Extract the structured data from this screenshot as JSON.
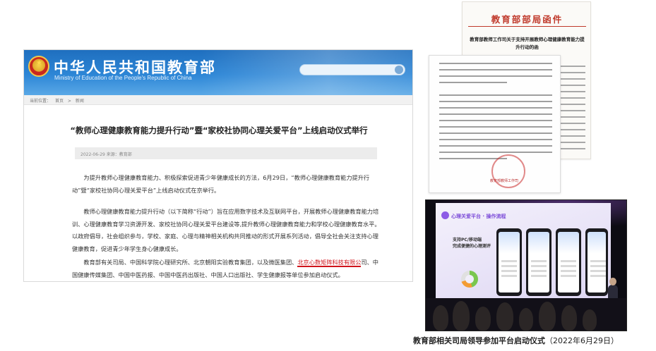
{
  "webpage": {
    "site_title": "中华人民共和国教育部",
    "site_subtitle": "Ministry of Education of the People's Republic of China",
    "breadcrumb": [
      "当前位置：",
      "首页",
      ">",
      "新闻"
    ],
    "article_title": "“教师心理健康教育能力提升行动”暨“家校社协同心理关爱平台”上线启动仪式举行",
    "article_meta": "2022-06-29    来源：教育部",
    "paragraph_1": "为提升教师心理健康教育能力、积极探索促进青少年健康成长的方法，6月29日，“教师心理健康教育能力提升行动”暨“家校社协同心理关爱平台”上线启动仪式在京举行。",
    "paragraph_2": "教师心理健康教育能力提升行动（以下简称“行动”）旨在应用数字技术及互联网平台，开展教师心理健康教育能力培训、心理健康教育学习资源开发、家校社协同心理关爱平台建设等,提升教师心理健康教育能力和学校心理健康教育水平。以政府倡导，社会组织参与，学校、家庭、心理与精神相关机构共同推动的形式开展系列活动，倡导全社会关注支持心理健康教育，促进青少年学生身心健康成长。",
    "paragraph_3_before": "教育部有关司局、中国科学院心理研究所、北京朝阳实验教育集团，以及微医集团、",
    "paragraph_3_highlight": "北京心数矩阵科技有限公",
    "paragraph_3_after": "司、中国健康传媒集团、中国中医药报、中国中医药出版社、中国人口出版社、学生健康报等单位参加启动仪式。",
    "highlight_color": "#d0141b"
  },
  "letter": {
    "header": "教育部部局函件",
    "subject": "教育部教师工作司关于支持开展教师心理健康教育能力提升行动的函"
  },
  "plan_doc": {
    "seal_text": "教育部教师工作司"
  },
  "photo": {
    "screen_title": "心理关爱平台 · 操作流程",
    "screen_heading": "支持PC/移动端\n完成便捷的心理测评"
  },
  "caption": {
    "text": "教育部相关司局领导参加平台启动仪式",
    "date": "（2022年6月29日）"
  }
}
